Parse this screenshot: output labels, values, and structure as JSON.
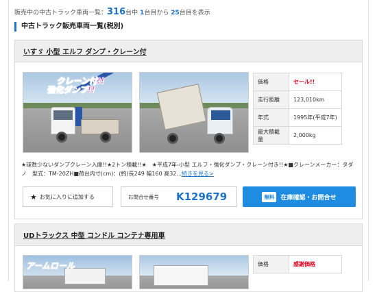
{
  "listing": {
    "prefix": "販売中の中古トラック車両一覧：",
    "total": "316",
    "mid1": "台中",
    "from": "1",
    "mid2": "台目から",
    "to": "25",
    "suffix": "台目を表示"
  },
  "section_title": "中古トラック販売車両一覧(税別)",
  "card1": {
    "title": "いすゞ 小型 エルフ ダンプ・クレーン付",
    "photo_overlay_line1": "クレーン付!!",
    "photo_overlay_line2": "強化ダンプ!!",
    "specs": [
      {
        "key": "価格",
        "value": "セール!!"
      },
      {
        "key": "走行距離",
        "value": "123,010km"
      },
      {
        "key": "年式",
        "value": "1995年(平成7年)"
      },
      {
        "key": "最大積載量",
        "value": "2,000kg"
      }
    ],
    "description": "★球数少ないダンプクレーン入庫!!★2トン積載!!★　★平成7年-小型 エルフ・強化ダンプ・クレーン付き!!★■クレーンメーカー：タダノ　型式：TM-20ZH■荷台内寸(cm)：(約)長249 幅160 高32...",
    "more_link": "続きを見る>",
    "favorite_label": "お気に入りに追加する",
    "inquiry_label": "お問合せ番号",
    "inquiry_code": "K129679",
    "cta_badge": "無料",
    "cta_label": "在庫確認・お問合せ"
  },
  "card2": {
    "title": "UDトラックス 中型 コンドル コンテナ専用車",
    "photo_overlay": "アームロール",
    "specs": [
      {
        "key": "価格",
        "value": "感謝価格"
      }
    ]
  },
  "colors": {
    "accent_blue": "#1e73c8",
    "cta_blue": "#1e8ce0",
    "sale_red": "#e0001b",
    "overlay_pink": "#ff4fbf"
  }
}
